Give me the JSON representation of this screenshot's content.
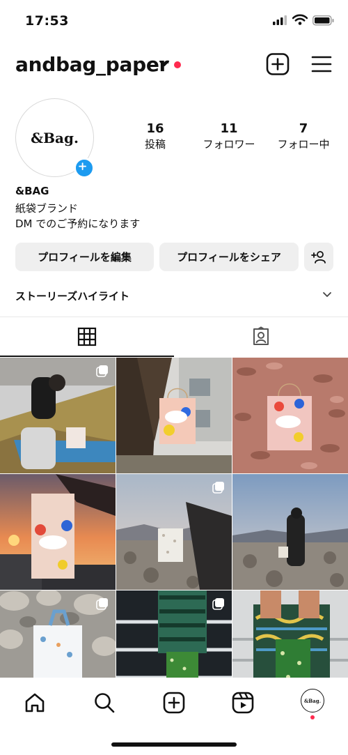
{
  "status_bar": {
    "time": "17:53"
  },
  "profile": {
    "username": "andbag_paper",
    "avatar_logo": "&Bag.",
    "stats": [
      {
        "value": "16",
        "label": "投稿"
      },
      {
        "value": "11",
        "label": "フォロワー"
      },
      {
        "value": "7",
        "label": "フォロー中"
      }
    ],
    "name": "&BAG",
    "bio_line1": "紙袋ブランド",
    "bio_line2": "DM でのご予約になります"
  },
  "buttons": {
    "edit": "プロフィールを編集",
    "share": "プロフィールをシェア"
  },
  "highlights": {
    "title": "ストーリーズハイライト"
  },
  "nav": {
    "profile_logo": "&Bag."
  },
  "colors": {
    "accent_blue": "#1d9bf0",
    "notification_red": "#ff2b4f"
  }
}
